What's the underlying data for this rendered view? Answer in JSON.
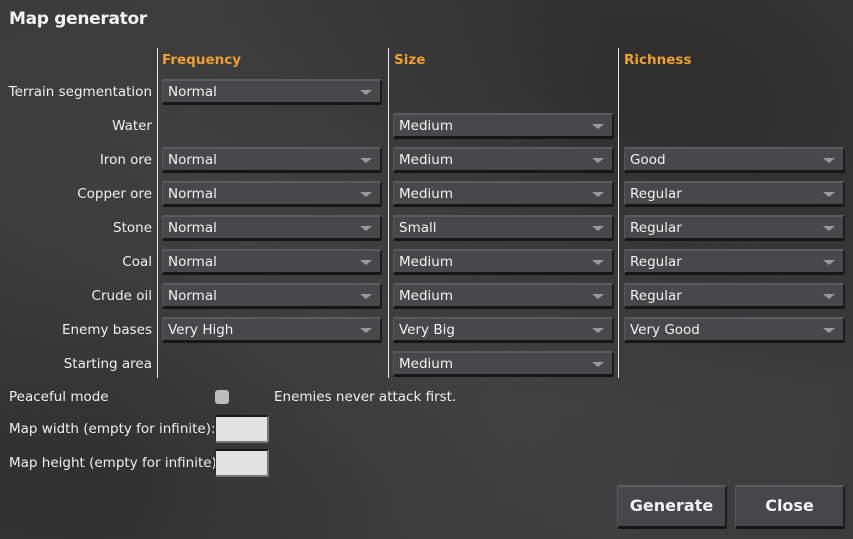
{
  "window": {
    "title": "Map generator"
  },
  "columns": {
    "frequency": "Frequency",
    "size": "Size",
    "richness": "Richness"
  },
  "rows": [
    {
      "label": "Terrain segmentation",
      "frequency": "Normal",
      "size": null,
      "richness": null
    },
    {
      "label": "Water",
      "frequency": null,
      "size": "Medium",
      "richness": null
    },
    {
      "label": "Iron ore",
      "frequency": "Normal",
      "size": "Medium",
      "richness": "Good"
    },
    {
      "label": "Copper ore",
      "frequency": "Normal",
      "size": "Medium",
      "richness": "Regular"
    },
    {
      "label": "Stone",
      "frequency": "Normal",
      "size": "Small",
      "richness": "Regular"
    },
    {
      "label": "Coal",
      "frequency": "Normal",
      "size": "Medium",
      "richness": "Regular"
    },
    {
      "label": "Crude oil",
      "frequency": "Normal",
      "size": "Medium",
      "richness": "Regular"
    },
    {
      "label": "Enemy bases",
      "frequency": "Very High",
      "size": "Very Big",
      "richness": "Very Good"
    },
    {
      "label": "Starting area",
      "frequency": null,
      "size": "Medium",
      "richness": null
    }
  ],
  "peaceful": {
    "label": "Peaceful mode",
    "checked": false,
    "description": "Enemies never attack first."
  },
  "map_width": {
    "label": "Map width (empty for infinite):",
    "value": ""
  },
  "map_height": {
    "label": "Map height (empty for infinite):",
    "value": ""
  },
  "buttons": {
    "generate": "Generate",
    "close": "Close"
  },
  "colors": {
    "accent": "#f0a030",
    "panel": "#3a3a3b",
    "dropdown": "#48474a"
  }
}
